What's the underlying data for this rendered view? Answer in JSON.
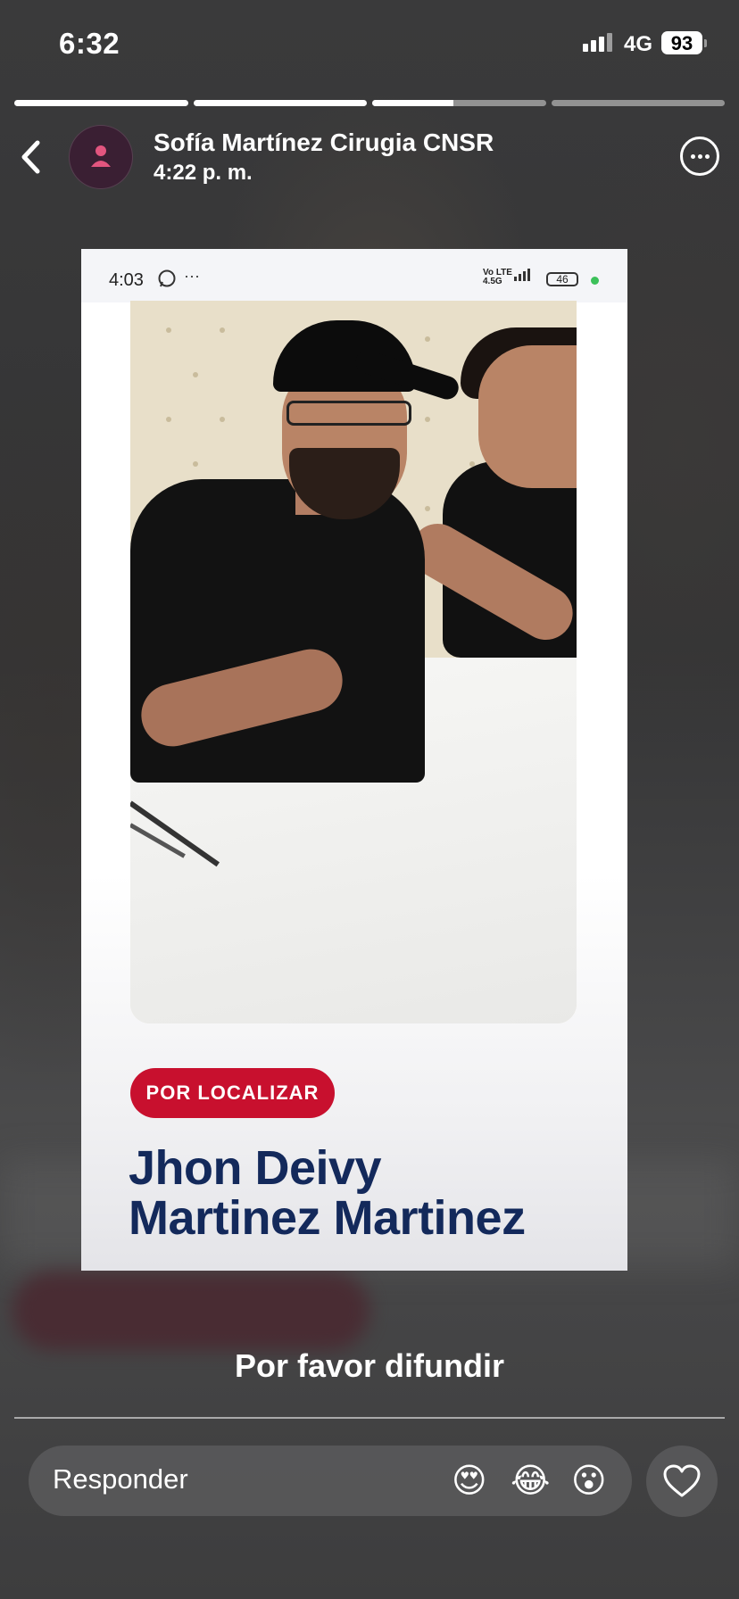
{
  "status_bar": {
    "time": "6:32",
    "network": "4G",
    "battery": "93"
  },
  "story_progress": [
    1,
    1,
    0.47,
    0
  ],
  "header": {
    "username": "Sofía Martínez Cirugia CNSR",
    "posted_time": "4:22 p. m.",
    "back_icon": "chevron-left-icon",
    "more_icon": "more-options-icon"
  },
  "card": {
    "inner_status": {
      "time": "4:03",
      "dots": "···",
      "network": "Vo LTE 4.5G",
      "battery": "46"
    },
    "badge": "POR LOCALIZAR",
    "name_line1": "Jhon Deivy",
    "name_line2": "Martinez Martinez",
    "colors": {
      "badge": "#c8102e",
      "name": "#13295b"
    }
  },
  "caption": "Por favor difundir",
  "reply_bar": {
    "placeholder": "Responder",
    "reactions": [
      "😍",
      "😂",
      "😮"
    ],
    "heart_icon": "heart-icon"
  }
}
